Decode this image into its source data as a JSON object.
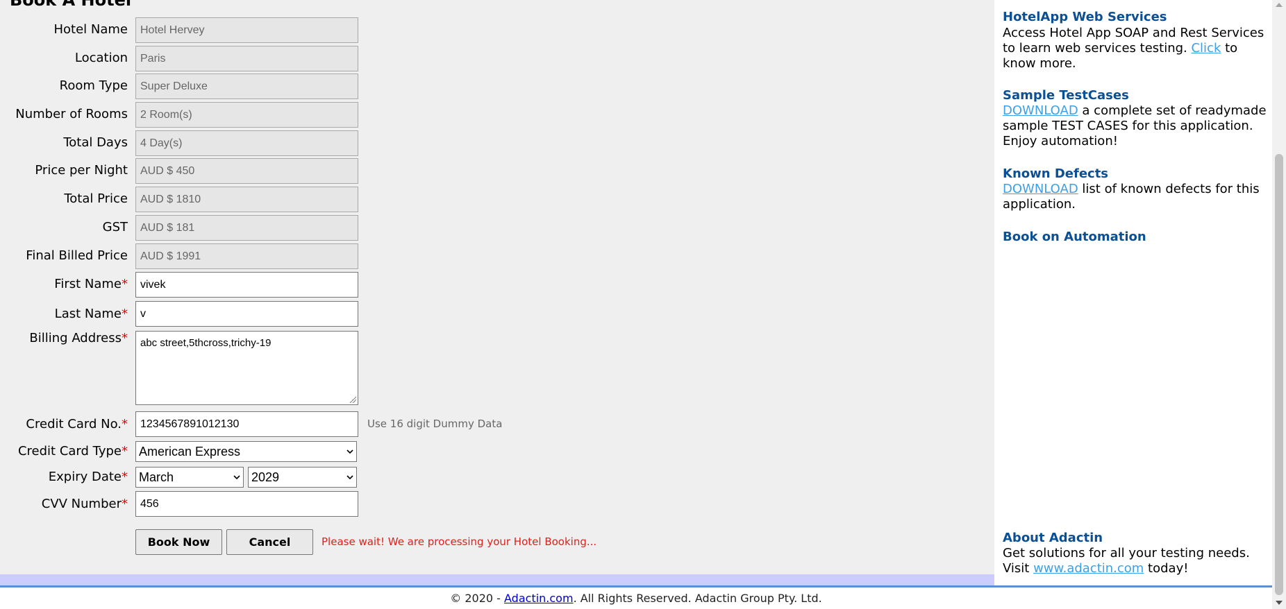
{
  "page_title": "Book A Hotel",
  "form": {
    "hotel_name": {
      "label": "Hotel Name",
      "value": "Hotel Hervey"
    },
    "location": {
      "label": "Location",
      "value": "Paris"
    },
    "room_type": {
      "label": "Room Type",
      "value": "Super Deluxe"
    },
    "number_of_rooms": {
      "label": "Number of Rooms",
      "value": "2 Room(s)"
    },
    "total_days": {
      "label": "Total Days",
      "value": "4 Day(s)"
    },
    "price_per_night": {
      "label": "Price per Night",
      "value": "AUD $ 450"
    },
    "total_price": {
      "label": "Total Price",
      "value": "AUD $ 1810"
    },
    "gst": {
      "label": "GST",
      "value": "AUD $ 181"
    },
    "final_billed_price": {
      "label": "Final Billed Price",
      "value": "AUD $ 1991"
    },
    "first_name": {
      "label": "First Name",
      "value": "vivek"
    },
    "last_name": {
      "label": "Last Name",
      "value": "v"
    },
    "billing_address": {
      "label": "Billing Address",
      "value": "abc street,5thcross,trichy-19"
    },
    "credit_card_no": {
      "label": "Credit Card No.",
      "value": "1234567891012130",
      "hint": "Use 16 digit Dummy Data"
    },
    "credit_card_type": {
      "label": "Credit Card Type",
      "value": "American Express"
    },
    "expiry_date": {
      "label": "Expiry Date",
      "month": "March",
      "year": "2029"
    },
    "cvv_number": {
      "label": "CVV Number",
      "value": "456"
    },
    "required_marker": "*",
    "book_now_label": "Book Now",
    "cancel_label": "Cancel",
    "processing_message": "Please wait! We are processing your Hotel Booking..."
  },
  "sidebar": {
    "web_services": {
      "heading": "HotelApp Web Services",
      "text_before": "Access Hotel App SOAP and Rest Services to learn web services testing. ",
      "link": "Click",
      "text_after": " to know more."
    },
    "test_cases": {
      "heading": "Sample TestCases",
      "link": "DOWNLOAD",
      "text_after": " a complete set of readymade sample TEST CASES for this application. Enjoy automation!"
    },
    "known_defects": {
      "heading": "Known Defects",
      "link": "DOWNLOAD",
      "text_after": " list of known defects for this application."
    },
    "book_automation": {
      "heading": "Book on Automation"
    },
    "about": {
      "heading": "About Adactin",
      "text_before": "Get solutions for all your testing needs. Visit ",
      "link": "www.adactin.com",
      "text_after": " today!"
    }
  },
  "footer": {
    "prefix": "© 2020 - ",
    "link": "Adactin.com",
    "suffix": ". All Rights Reserved. Adactin Group Pty. Ltd."
  },
  "colors": {
    "link": "#3ca0e6",
    "heading": "#0b4f94",
    "required": "#e00000",
    "processing": "#e0201c",
    "footer_line": "#5b8fd0"
  }
}
